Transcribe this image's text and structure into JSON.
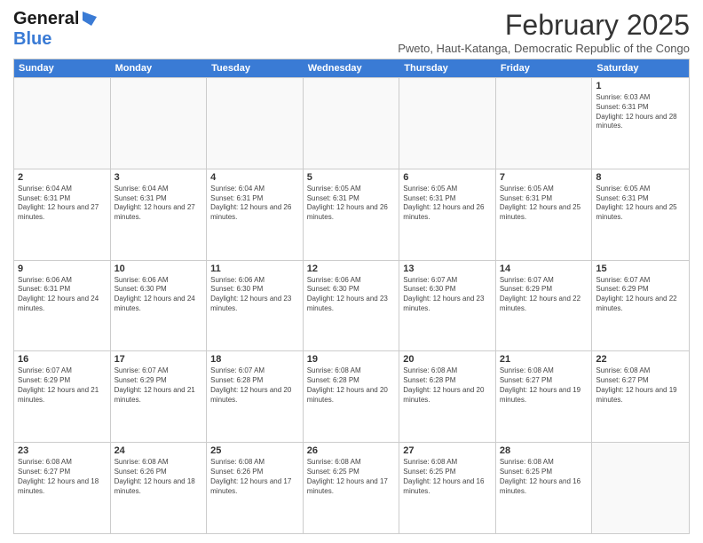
{
  "header": {
    "logo": {
      "line1": "General",
      "line2": "Blue"
    },
    "month": "February 2025",
    "location": "Pweto, Haut-Katanga, Democratic Republic of the Congo"
  },
  "weekdays": [
    "Sunday",
    "Monday",
    "Tuesday",
    "Wednesday",
    "Thursday",
    "Friday",
    "Saturday"
  ],
  "weeks": [
    [
      {
        "day": "",
        "empty": true
      },
      {
        "day": "",
        "empty": true
      },
      {
        "day": "",
        "empty": true
      },
      {
        "day": "",
        "empty": true
      },
      {
        "day": "",
        "empty": true
      },
      {
        "day": "",
        "empty": true
      },
      {
        "day": "1",
        "sunrise": "6:03 AM",
        "sunset": "6:31 PM",
        "daylight": "12 hours and 28 minutes."
      }
    ],
    [
      {
        "day": "2",
        "sunrise": "6:04 AM",
        "sunset": "6:31 PM",
        "daylight": "12 hours and 27 minutes."
      },
      {
        "day": "3",
        "sunrise": "6:04 AM",
        "sunset": "6:31 PM",
        "daylight": "12 hours and 27 minutes."
      },
      {
        "day": "4",
        "sunrise": "6:04 AM",
        "sunset": "6:31 PM",
        "daylight": "12 hours and 26 minutes."
      },
      {
        "day": "5",
        "sunrise": "6:05 AM",
        "sunset": "6:31 PM",
        "daylight": "12 hours and 26 minutes."
      },
      {
        "day": "6",
        "sunrise": "6:05 AM",
        "sunset": "6:31 PM",
        "daylight": "12 hours and 26 minutes."
      },
      {
        "day": "7",
        "sunrise": "6:05 AM",
        "sunset": "6:31 PM",
        "daylight": "12 hours and 25 minutes."
      },
      {
        "day": "8",
        "sunrise": "6:05 AM",
        "sunset": "6:31 PM",
        "daylight": "12 hours and 25 minutes."
      }
    ],
    [
      {
        "day": "9",
        "sunrise": "6:06 AM",
        "sunset": "6:31 PM",
        "daylight": "12 hours and 24 minutes."
      },
      {
        "day": "10",
        "sunrise": "6:06 AM",
        "sunset": "6:30 PM",
        "daylight": "12 hours and 24 minutes."
      },
      {
        "day": "11",
        "sunrise": "6:06 AM",
        "sunset": "6:30 PM",
        "daylight": "12 hours and 23 minutes."
      },
      {
        "day": "12",
        "sunrise": "6:06 AM",
        "sunset": "6:30 PM",
        "daylight": "12 hours and 23 minutes."
      },
      {
        "day": "13",
        "sunrise": "6:07 AM",
        "sunset": "6:30 PM",
        "daylight": "12 hours and 23 minutes."
      },
      {
        "day": "14",
        "sunrise": "6:07 AM",
        "sunset": "6:29 PM",
        "daylight": "12 hours and 22 minutes."
      },
      {
        "day": "15",
        "sunrise": "6:07 AM",
        "sunset": "6:29 PM",
        "daylight": "12 hours and 22 minutes."
      }
    ],
    [
      {
        "day": "16",
        "sunrise": "6:07 AM",
        "sunset": "6:29 PM",
        "daylight": "12 hours and 21 minutes."
      },
      {
        "day": "17",
        "sunrise": "6:07 AM",
        "sunset": "6:29 PM",
        "daylight": "12 hours and 21 minutes."
      },
      {
        "day": "18",
        "sunrise": "6:07 AM",
        "sunset": "6:28 PM",
        "daylight": "12 hours and 20 minutes."
      },
      {
        "day": "19",
        "sunrise": "6:08 AM",
        "sunset": "6:28 PM",
        "daylight": "12 hours and 20 minutes."
      },
      {
        "day": "20",
        "sunrise": "6:08 AM",
        "sunset": "6:28 PM",
        "daylight": "12 hours and 20 minutes."
      },
      {
        "day": "21",
        "sunrise": "6:08 AM",
        "sunset": "6:27 PM",
        "daylight": "12 hours and 19 minutes."
      },
      {
        "day": "22",
        "sunrise": "6:08 AM",
        "sunset": "6:27 PM",
        "daylight": "12 hours and 19 minutes."
      }
    ],
    [
      {
        "day": "23",
        "sunrise": "6:08 AM",
        "sunset": "6:27 PM",
        "daylight": "12 hours and 18 minutes."
      },
      {
        "day": "24",
        "sunrise": "6:08 AM",
        "sunset": "6:26 PM",
        "daylight": "12 hours and 18 minutes."
      },
      {
        "day": "25",
        "sunrise": "6:08 AM",
        "sunset": "6:26 PM",
        "daylight": "12 hours and 17 minutes."
      },
      {
        "day": "26",
        "sunrise": "6:08 AM",
        "sunset": "6:25 PM",
        "daylight": "12 hours and 17 minutes."
      },
      {
        "day": "27",
        "sunrise": "6:08 AM",
        "sunset": "6:25 PM",
        "daylight": "12 hours and 16 minutes."
      },
      {
        "day": "28",
        "sunrise": "6:08 AM",
        "sunset": "6:25 PM",
        "daylight": "12 hours and 16 minutes."
      },
      {
        "day": "",
        "empty": true
      }
    ]
  ]
}
